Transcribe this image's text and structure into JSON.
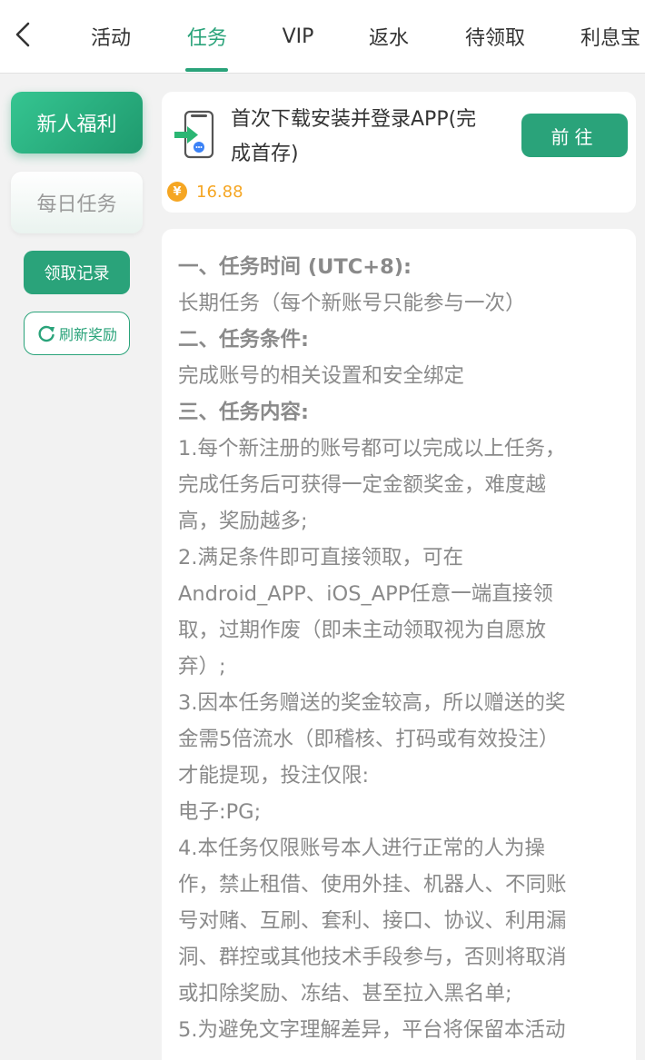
{
  "nav": {
    "tabs": [
      {
        "label": "活动"
      },
      {
        "label": "任务"
      },
      {
        "label": "VIP"
      },
      {
        "label": "返水"
      },
      {
        "label": "待领取"
      },
      {
        "label": "利息宝"
      }
    ],
    "active_tab": "任务"
  },
  "sidebar": {
    "categories": [
      {
        "label": "新人福利"
      },
      {
        "label": "每日任务"
      }
    ],
    "records_label": "领取记录",
    "refresh_label": "刷新奖励"
  },
  "task": {
    "title_line1": "首次下载安装并登录APP(完",
    "title_line2": "成首存)",
    "go_label": "前往",
    "reward_symbol": "¥",
    "reward_value": "16.88"
  },
  "rules": {
    "lines": [
      "一、任务时间 (UTC+8):",
      "长期任务（每个新账号只能参与一次）",
      "二、任务条件:",
      "完成账号的相关设置和安全绑定",
      "三、任务内容:",
      "1.每个新注册的账号都可以完成以上任务，",
      "完成任务后可获得一定金额奖金，难度越",
      "高，奖励越多;",
      "2.满足条件即可直接领取，可在",
      "Android_APP、iOS_APP任意一端直接领",
      "取，过期作废（即未主动领取视为自愿放",
      "弃）;",
      "3.因本任务赠送的奖金较高，所以赠送的奖",
      "金需5倍流水（即稽核、打码或有效投注）",
      "才能提现，投注仅限:",
      "电子:PG;",
      "4.本任务仅限账号本人进行正常的人为操",
      "作，禁止租借、使用外挂、机器人、不同账",
      "号对赌、互刷、套利、接口、协议、利用漏",
      "洞、群控或其他技术手段参与，否则将取消",
      "或扣除奖励、冻结、甚至拉入黑名单;",
      "5.为避免文字理解差异，平台将保留本活动"
    ]
  },
  "colors": {
    "accent": "#2aa37a",
    "reward": "#f5a623",
    "rule_text": "#8a8a8a"
  }
}
